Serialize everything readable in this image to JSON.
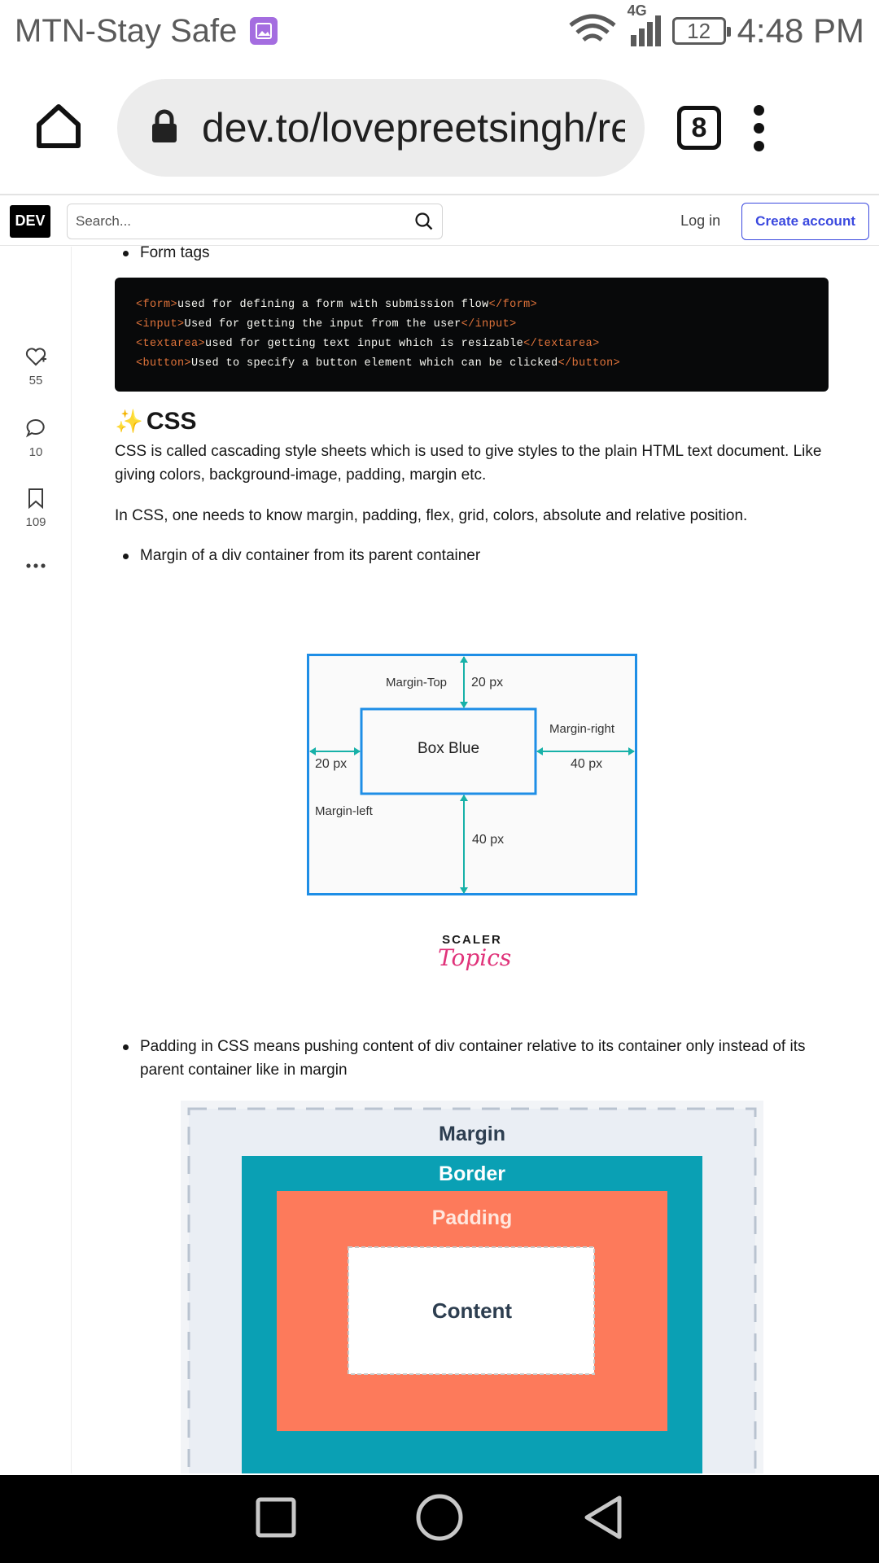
{
  "status_bar": {
    "carrier": "MTN-Stay Safe",
    "network": "4G",
    "battery": "12",
    "time": "4:48 PM"
  },
  "browser": {
    "url": "dev.to/lovepreetsingh/re",
    "tab_count": "8"
  },
  "dev_header": {
    "logo": "DEV",
    "search_placeholder": "Search...",
    "login": "Log in",
    "create_account": "Create account"
  },
  "sidebar": {
    "reactions": "55",
    "comments": "10",
    "bookmarks": "109"
  },
  "article": {
    "bullet_form_tags": "Form tags",
    "code_lines": [
      {
        "open": "<form>",
        "text": "used for defining a form with submission flow",
        "close": "</form>"
      },
      {
        "open": "<input>",
        "text": "Used for getting the input from the user",
        "close": "</input>"
      },
      {
        "open": "<textarea>",
        "text": "used for getting text input which is resizable",
        "close": "</textarea>"
      },
      {
        "open": "<button>",
        "text": "Used to specify a button element which can be clicked",
        "close": "</button>"
      }
    ],
    "heading_emoji": "✨",
    "heading": "CSS",
    "para1": "CSS is called cascading style sheets which is used to give styles to the plain HTML text document. Like giving colors, background-image, padding, margin etc.",
    "para2": "In CSS, one needs to know margin, padding, flex, grid, colors, absolute and relative position.",
    "bullet_margin": "Margin of a div container from its parent container",
    "bullet_padding": "Padding in CSS means pushing content of div container relative to its container only instead of its parent container like in margin"
  },
  "margin_diagram": {
    "box_label": "Box Blue",
    "top_label": "Margin-Top",
    "top_value": "20 px",
    "right_label": "Margin-right",
    "right_value": "40 px",
    "left_value": "20 px",
    "left_label": "Margin-left",
    "bottom_value": "40 px",
    "logo_top": "SCALER",
    "logo_bottom": "Topics"
  },
  "box_model_diagram": {
    "margin": "Margin",
    "border": "Border",
    "padding": "Padding",
    "content": "Content"
  },
  "colors": {
    "code_tag": "#e0733a",
    "dev_link": "#3b49df",
    "diagram_blue": "#1e8ee6",
    "diagram_teal": "#17b1a8",
    "box_border": "#0aa0b4",
    "box_padding": "#fd7a5b"
  }
}
